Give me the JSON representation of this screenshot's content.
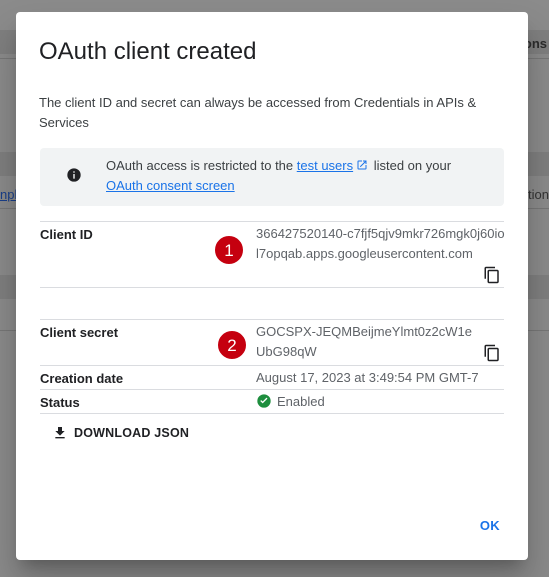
{
  "background": {
    "right_header_fragment": "ons",
    "left_link_fragment": "nple",
    "right_text_fragment": "ction"
  },
  "dialog": {
    "title": "OAuth client created",
    "description": "The client ID and secret can always be accessed from Credentials in APIs & Services",
    "notice": {
      "icon": "info-icon",
      "text_before": "OAuth access is restricted to the ",
      "test_users_link": "test users",
      "text_middle": " listed on your ",
      "consent_screen_link": "OAuth consent screen"
    },
    "fields": {
      "client_id": {
        "label": "Client ID",
        "value": "366427520140-c7fjf5qjv9mkr726mgk0j60iol7opqab.apps.googleusercontent.com",
        "marker": "1"
      },
      "client_secret": {
        "label": "Client secret",
        "value": "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",
        "marker": "2"
      },
      "creation_date": {
        "label": "Creation date",
        "value": "August 17, 2023 at 3:49:54 PM GMT-7"
      },
      "status": {
        "label": "Status",
        "value": "Enabled",
        "icon": "check-circle-icon",
        "color": "#1e8e3e"
      }
    },
    "download_label": "DOWNLOAD JSON",
    "ok_label": "OK"
  },
  "colors": {
    "accent": "#1a73e8",
    "marker": "#c5000f"
  }
}
